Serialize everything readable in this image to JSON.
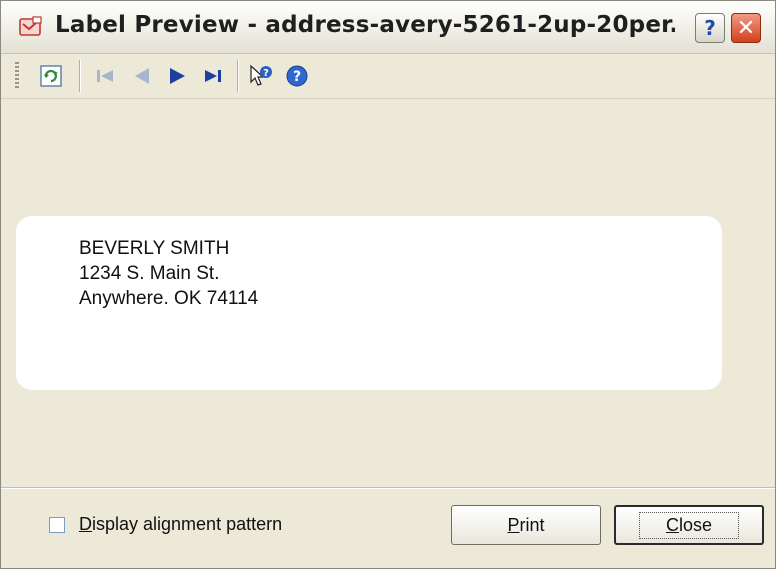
{
  "window": {
    "title": "Label Preview - address-avery-5261-2up-20per...",
    "help_glyph": "?",
    "close_glyph": "✕"
  },
  "toolbar": {
    "icons": [
      "refresh-icon",
      "first-page-icon",
      "previous-page-icon",
      "next-page-icon",
      "last-page-icon",
      "whats-this-icon",
      "help-icon"
    ]
  },
  "label": {
    "lines": [
      "BEVERLY SMITH",
      "1234 S. Main St.",
      "Anywhere. OK 74114"
    ]
  },
  "footer": {
    "checkbox_label_accel": "D",
    "checkbox_label_rest": "isplay alignment pattern",
    "checkbox_checked": false,
    "print_accel": "P",
    "print_rest": "rint",
    "close_accel": "C",
    "close_rest": "lose"
  },
  "colors": {
    "window_bg": "#ece9d8",
    "label_bg": "#ffffff",
    "nav_blue": "#1d3f9e",
    "close_red": "#d2401c"
  }
}
